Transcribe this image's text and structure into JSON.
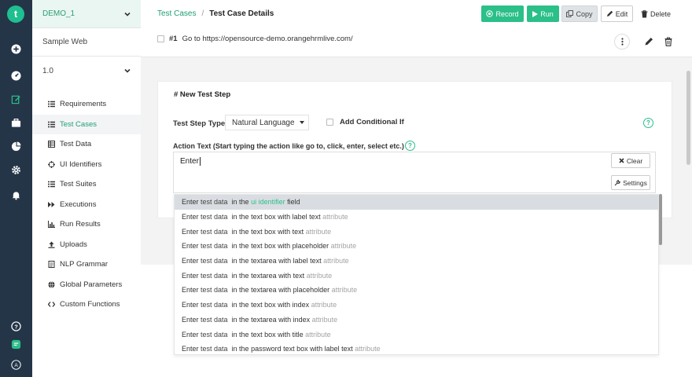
{
  "rail": {
    "logo": "t",
    "avatar_letter": "A"
  },
  "sidebar": {
    "project": "DEMO_1",
    "app": "Sample Web",
    "version": "1.0",
    "items": [
      {
        "label": "Requirements",
        "icon": "list-icon"
      },
      {
        "label": "Test Cases",
        "icon": "list-icon",
        "active": true
      },
      {
        "label": "Test Data",
        "icon": "table-icon"
      },
      {
        "label": "UI Identifiers",
        "icon": "target-icon"
      },
      {
        "label": "Test Suites",
        "icon": "list-icon"
      },
      {
        "label": "Executions",
        "icon": "fast-forward-icon"
      },
      {
        "label": "Run Results",
        "icon": "bar-chart-icon"
      },
      {
        "label": "Uploads",
        "icon": "upload-icon"
      },
      {
        "label": "NLP Grammar",
        "icon": "document-icon"
      },
      {
        "label": "Global Parameters",
        "icon": "globe-icon"
      },
      {
        "label": "Custom Functions",
        "icon": "code-icon"
      }
    ]
  },
  "header": {
    "breadcrumb_link": "Test Cases",
    "breadcrumb_sep": "/",
    "breadcrumb_current": "Test Case Details",
    "record_label": "Record",
    "run_label": "Run",
    "copy_label": "Copy",
    "edit_label": "Edit",
    "delete_label": "Delete",
    "accent": "#2bbf89"
  },
  "existing_step": {
    "number": "#1",
    "text": "Go to  https://opensource-demo.orangehrmlive.com/"
  },
  "new_step": {
    "title": "# New Test Step",
    "type_label": "Test Step Type",
    "type_value": "Natural Language",
    "conditional_label": "Add Conditional If",
    "action_label": "Action Text (Start typing the action like go to, click, enter, select etc.)",
    "required_mark": "*",
    "action_value": "Enter",
    "clear_label": "Clear",
    "settings_label": "Settings"
  },
  "suggestions": [
    {
      "head": "Enter ",
      "data": "test data",
      "mid": "  in the ",
      "tail": "ui identifier",
      "tail_style": "g",
      "end": " field",
      "highlight": true
    },
    {
      "head": "Enter ",
      "data": "test data",
      "mid": "  in the text box with label text ",
      "tail": "attribute",
      "tail_style": "a",
      "end": ""
    },
    {
      "head": "Enter ",
      "data": "test data",
      "mid": "  in the text box with text ",
      "tail": "attribute",
      "tail_style": "a",
      "end": ""
    },
    {
      "head": "Enter ",
      "data": "test data",
      "mid": "  in the text box with placeholder ",
      "tail": "attribute",
      "tail_style": "a",
      "end": ""
    },
    {
      "head": "Enter ",
      "data": "test data",
      "mid": "  in the textarea with label text ",
      "tail": "attribute",
      "tail_style": "a",
      "end": ""
    },
    {
      "head": "Enter ",
      "data": "test data",
      "mid": "  in the textarea with text ",
      "tail": "attribute",
      "tail_style": "a",
      "end": ""
    },
    {
      "head": "Enter ",
      "data": "test data",
      "mid": "  in the textarea with placeholder ",
      "tail": "attribute",
      "tail_style": "a",
      "end": ""
    },
    {
      "head": "Enter ",
      "data": "test data",
      "mid": "  in the text box with index ",
      "tail": "attribute",
      "tail_style": "a",
      "end": ""
    },
    {
      "head": "Enter ",
      "data": "test data",
      "mid": "  in the textarea with index ",
      "tail": "attribute",
      "tail_style": "a",
      "end": ""
    },
    {
      "head": "Enter ",
      "data": "test data",
      "mid": "  in the text box with title ",
      "tail": "attribute",
      "tail_style": "a",
      "end": ""
    },
    {
      "head": "Enter ",
      "data": "test data",
      "mid": "  in the password text box with label text ",
      "tail": "attribute",
      "tail_style": "a",
      "end": ""
    }
  ]
}
